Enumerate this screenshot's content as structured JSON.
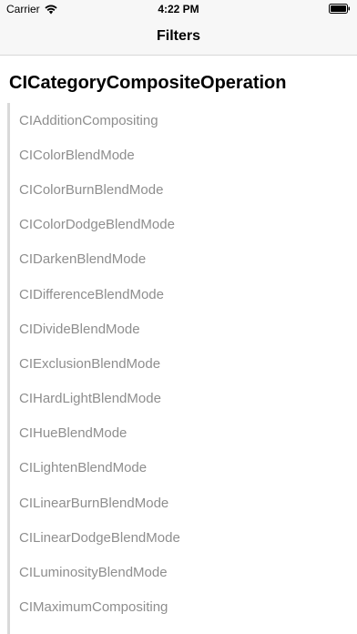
{
  "status_bar": {
    "carrier": "Carrier",
    "time": "4:22 PM",
    "wifi_icon": "wifi-icon",
    "battery_icon": "battery-icon"
  },
  "nav": {
    "title": "Filters"
  },
  "section": {
    "header": "CICategoryCompositeOperation"
  },
  "filters": [
    "CIAdditionCompositing",
    "CIColorBlendMode",
    "CIColorBurnBlendMode",
    "CIColorDodgeBlendMode",
    "CIDarkenBlendMode",
    "CIDifferenceBlendMode",
    "CIDivideBlendMode",
    "CIExclusionBlendMode",
    "CIHardLightBlendMode",
    "CIHueBlendMode",
    "CILightenBlendMode",
    "CILinearBurnBlendMode",
    "CILinearDodgeBlendMode",
    "CILuminosityBlendMode",
    "CIMaximumCompositing"
  ]
}
